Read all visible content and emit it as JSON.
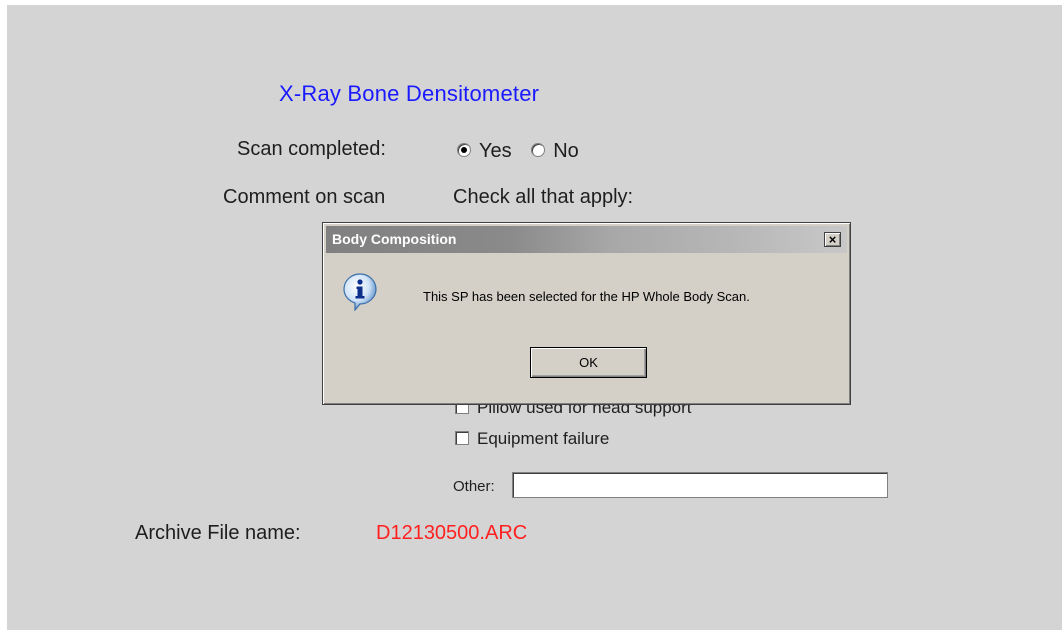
{
  "form": {
    "title": "X-Ray Bone Densitometer",
    "scan_completed_label": "Scan completed:",
    "radio_yes": "Yes",
    "radio_no": "No",
    "comment_label": "Comment on scan",
    "check_all_label": "Check all that apply:",
    "checkbox_pillow": "Pillow used for head support",
    "checkbox_equipment": "Equipment failure",
    "other_label": "Other:",
    "other_value": "",
    "archive_label": "Archive File name:",
    "archive_value": "D12130500.ARC"
  },
  "dialog": {
    "title": "Body Composition",
    "message": "This SP has been selected for the HP Whole Body Scan.",
    "ok_label": "OK",
    "close_glyph": "×",
    "icon": "info-icon"
  },
  "colors": {
    "panel": "#d4d4d4",
    "title": "#1a1aff",
    "archive_value": "#ff2020",
    "dialog_bg": "#d4d0c8"
  }
}
